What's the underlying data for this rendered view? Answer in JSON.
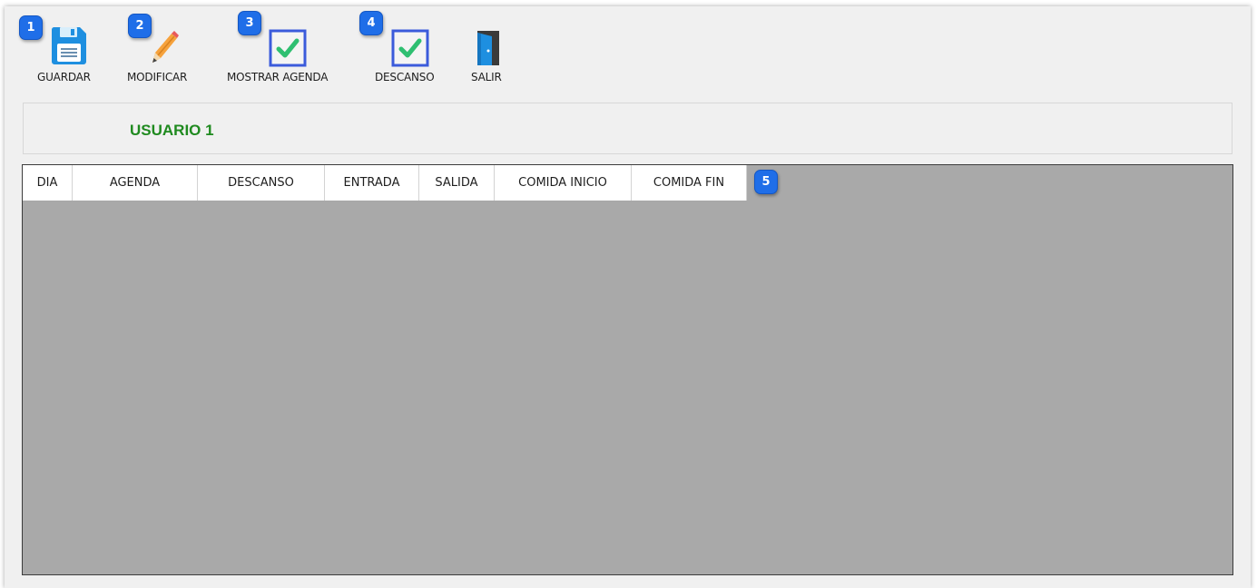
{
  "toolbar": {
    "guardar": {
      "label": "GUARDAR",
      "icon": "floppy-disk-icon"
    },
    "modificar": {
      "label": "MODIFICAR",
      "icon": "pencil-icon"
    },
    "mostrar_agenda": {
      "label": "MOSTRAR AGENDA",
      "icon": "checkbox-checked-icon",
      "checked": true
    },
    "descanso": {
      "label": "DESCANSO",
      "icon": "checkbox-checked-icon",
      "checked": true
    },
    "salir": {
      "label": "SALIR",
      "icon": "exit-door-icon"
    }
  },
  "callouts": [
    "1",
    "2",
    "3",
    "4",
    "5"
  ],
  "user": {
    "name": "USUARIO 1"
  },
  "grid": {
    "columns": [
      "DIA",
      "AGENDA",
      "DESCANSO",
      "ENTRADA",
      "SALIDA",
      "COMIDA INICIO",
      "COMIDA FIN"
    ],
    "rows": []
  },
  "colors": {
    "accent_badge": "#1f6ee8",
    "user_name": "#1f8a1f",
    "check_green": "#2fbf71",
    "checkbox_border": "#3b5bdb",
    "grid_background": "#a9a9a9"
  }
}
